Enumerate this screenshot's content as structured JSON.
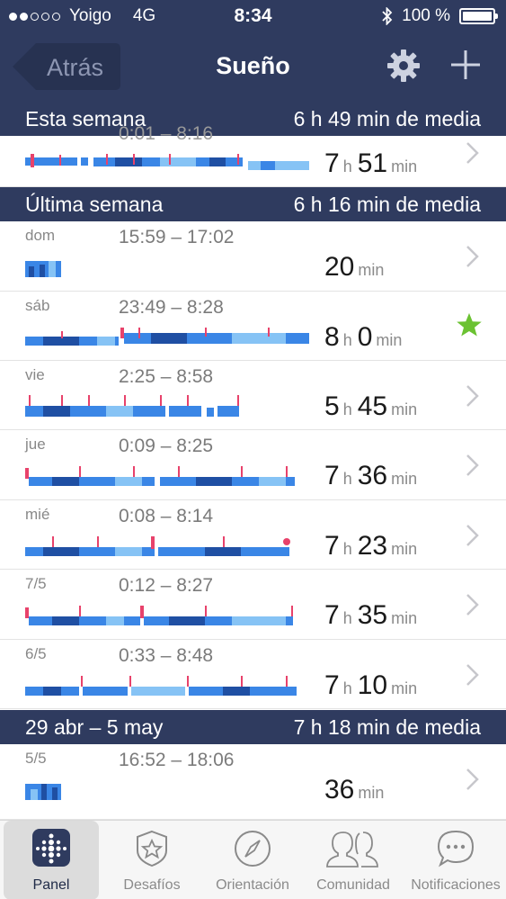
{
  "status": {
    "carrier": "Yoigo",
    "network": "4G",
    "time": "8:34",
    "battery": "100 %"
  },
  "nav": {
    "back": "Atrás",
    "title": "Sueño",
    "settings_icon": "gear-icon",
    "add_icon": "plus-icon"
  },
  "sections": [
    {
      "left": "Esta semana",
      "right": "6 h 49 min de media"
    },
    {
      "left": "Última semana",
      "right": "6 h 16 min de media"
    },
    {
      "left": "29 abr – 5 may",
      "right": "7 h 18 min de media"
    }
  ],
  "rows": [
    {
      "day": "",
      "range": "0:01 – 8:16",
      "h": "7",
      "m": "51"
    },
    {
      "day": "dom",
      "range": "15:59 – 17:02",
      "h": "",
      "m": "20"
    },
    {
      "day": "sáb",
      "range": "23:49 – 8:28",
      "h": "8",
      "m": "0",
      "starred": true
    },
    {
      "day": "vie",
      "range": "2:25 – 8:58",
      "h": "5",
      "m": "45"
    },
    {
      "day": "jue",
      "range": "0:09 – 8:25",
      "h": "7",
      "m": "36"
    },
    {
      "day": "mié",
      "range": "0:08 – 8:14",
      "h": "7",
      "m": "23"
    },
    {
      "day": "7/5",
      "range": "0:12 – 8:27",
      "h": "7",
      "m": "35"
    },
    {
      "day": "6/5",
      "range": "0:33 – 8:48",
      "h": "7",
      "m": "10"
    },
    {
      "day": "5/5",
      "range": "16:52 – 18:06",
      "h": "",
      "m": "36"
    }
  ],
  "units": {
    "h": "h",
    "min": "min"
  },
  "tabs": [
    {
      "label": "Panel",
      "icon": "fitbit-dots-icon",
      "active": true
    },
    {
      "label": "Desafíos",
      "icon": "star-badge-icon"
    },
    {
      "label": "Orientación",
      "icon": "compass-icon"
    },
    {
      "label": "Comunidad",
      "icon": "people-icon"
    },
    {
      "label": "Notificaciones",
      "icon": "chat-bubble-icon"
    }
  ],
  "colors": {
    "header": "#2f3b5f",
    "deep": "#1f4fa3",
    "mid": "#3a86e6",
    "light": "#86c3f5",
    "awake": "#e8426b",
    "star": "#6bc232"
  }
}
